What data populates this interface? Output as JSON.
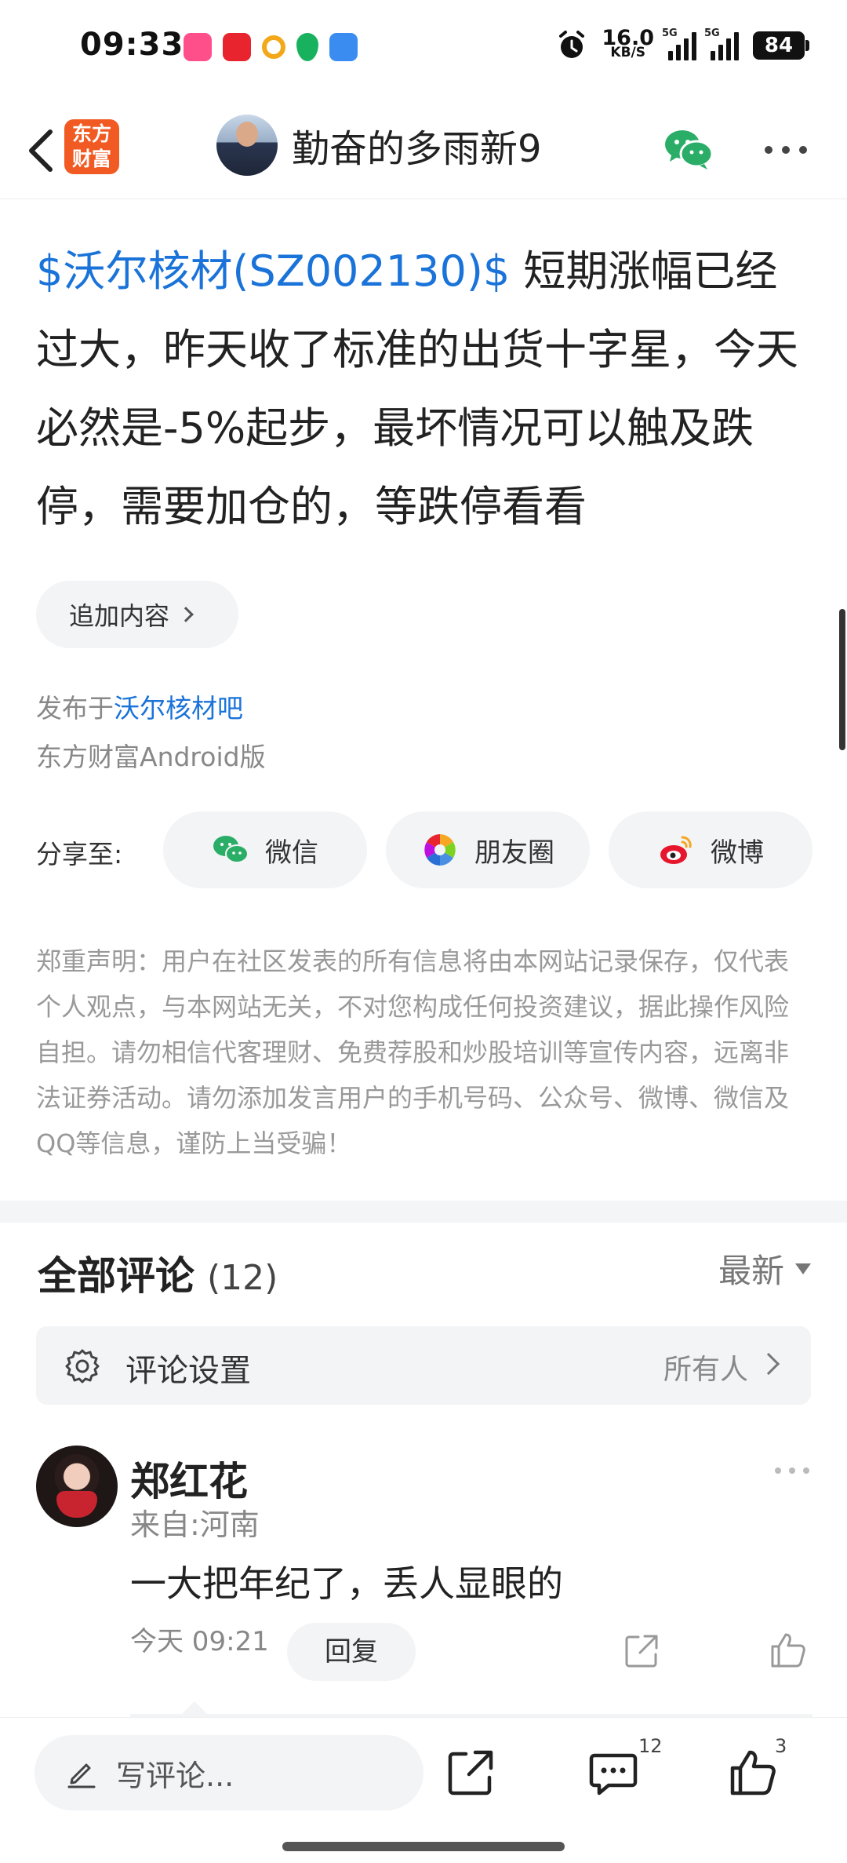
{
  "status_bar": {
    "time": "09:33",
    "net_speed_value": "16.0",
    "net_speed_unit": "KB/S",
    "signal1_label": "5G",
    "signal2_label": "5G",
    "battery": "84",
    "app_icon_colors": [
      "#ff4f8a",
      "#e8242f",
      "#f3a81a",
      "#18b25f",
      "#3b8cf0"
    ]
  },
  "header": {
    "logo_line1": "东方",
    "logo_line2": "财富",
    "username": "勤奋的多雨新9"
  },
  "post": {
    "stock_link": "$沃尔核材(SZ002130)$",
    "body": " 短期涨幅已经过大，昨天收了标准的出货十字星，今天必然是-5%起步，最坏情况可以触及跌停，需要加仓的，等跌停看看",
    "append_label": "追加内容",
    "published_prefix": "发布于",
    "published_bar": "沃尔核材吧",
    "client": "东方财富Android版"
  },
  "share": {
    "label": "分享至:",
    "wechat": "微信",
    "moments": "朋友圈",
    "weibo": "微博"
  },
  "disclaimer": "郑重声明：用户在社区发表的所有信息将由本网站记录保存，仅代表个人观点，与本网站无关，不对您构成任何投资建议，据此操作风险自担。请勿相信代客理财、免费荐股和炒股培训等宣传内容，远离非法证券活动。请勿添加发言用户的手机号码、公众号、微博、微信及QQ等信息，谨防上当受骗！",
  "comments": {
    "title": "全部评论",
    "count": "(12)",
    "sort": "最新",
    "settings_label": "评论设置",
    "settings_value": "所有人",
    "items": [
      {
        "name": "郑红花",
        "from": "来自:河南",
        "text": "一大把年纪了，丢人显眼的",
        "time": "今天 09:21",
        "reply_label": "回复"
      }
    ]
  },
  "bottom_bar": {
    "write_placeholder": "写评论...",
    "comment_count": "12",
    "like_count": "3"
  },
  "colors": {
    "link": "#1a73d9",
    "brand": "#f15a22",
    "wechat_green": "#2aae67",
    "weibo_red": "#e6162d"
  }
}
